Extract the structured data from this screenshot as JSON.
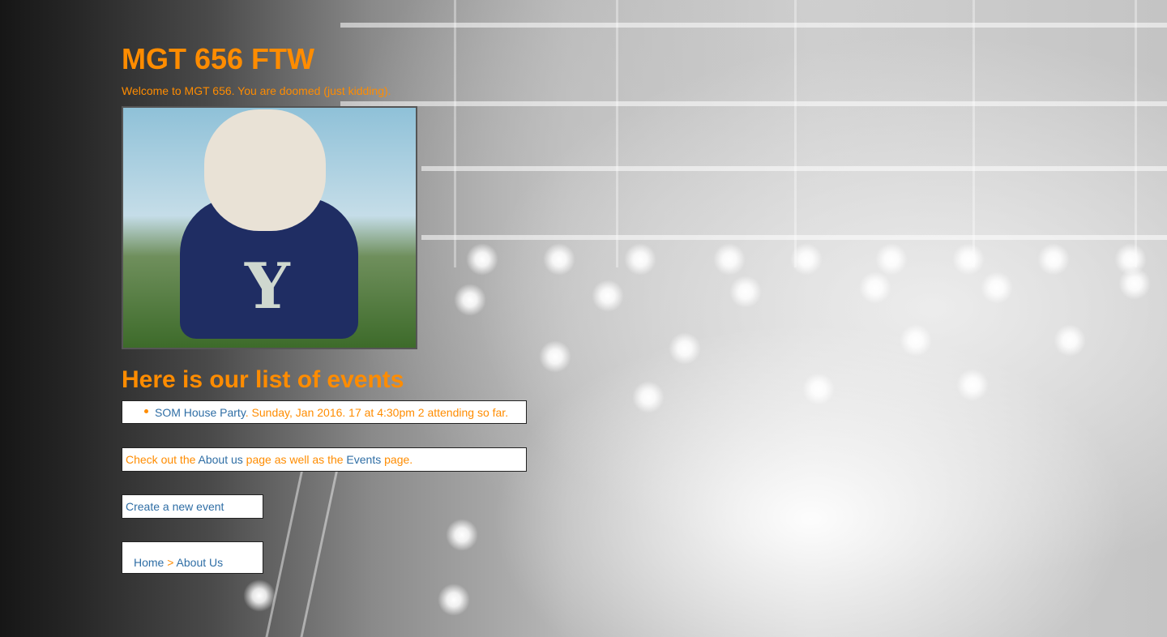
{
  "header": {
    "title": "MGT 656 FTW",
    "welcome": "Welcome to MGT 656. You are doomed (just kidding)."
  },
  "image": {
    "letter": "Y"
  },
  "events": {
    "heading": "Here is our list of events",
    "items": [
      {
        "name": "SOM House Party",
        "details": ". Sunday, Jan 2016. 17 at 4:30pm 2 attending so far."
      }
    ]
  },
  "links_section": {
    "prefix": "Check out the ",
    "about_label": "About us",
    "middle": " page as well as the ",
    "events_label": "Events",
    "suffix": " page."
  },
  "create_event": {
    "label": "Create a new event"
  },
  "breadcrumb": {
    "home": "Home",
    "separator": " > ",
    "current": "About Us"
  },
  "colors": {
    "accent": "#ff8c00",
    "link": "#2f6ea5",
    "box_bg": "#ffffff"
  }
}
